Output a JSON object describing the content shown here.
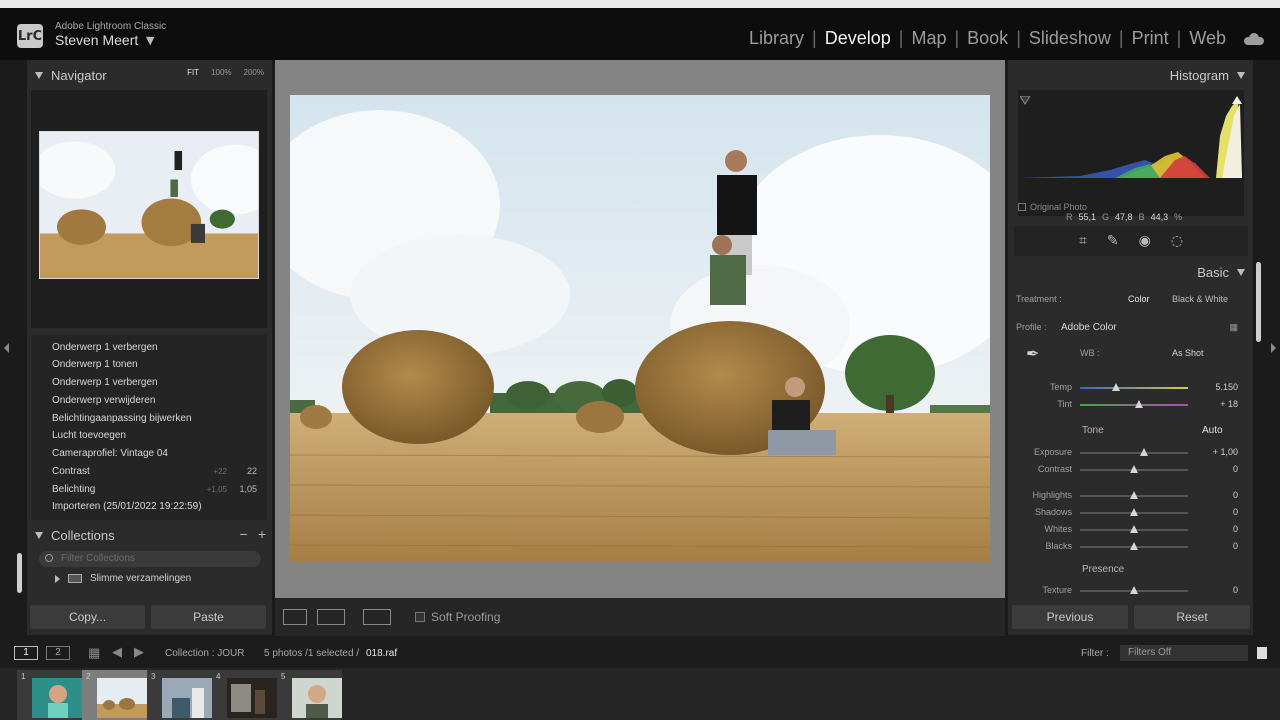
{
  "app": {
    "name": "Adobe Lightroom Classic",
    "logo": "LrC",
    "user": "Steven Meert"
  },
  "modules": [
    "Library",
    "Develop",
    "Map",
    "Book",
    "Slideshow",
    "Print",
    "Web"
  ],
  "active_module": "Develop",
  "navigator": {
    "title": "Navigator",
    "zoom": [
      "FIT",
      "100%",
      "200%"
    ]
  },
  "history": [
    {
      "label": "Onderwerp 1 verbergen",
      "old": "",
      "new": ""
    },
    {
      "label": "Onderwerp 1 tonen",
      "old": "",
      "new": ""
    },
    {
      "label": "Onderwerp 1 verbergen",
      "old": "",
      "new": ""
    },
    {
      "label": "Onderwerp verwijderen",
      "old": "",
      "new": ""
    },
    {
      "label": "Belichtingaanpassing bijwerken",
      "old": "",
      "new": ""
    },
    {
      "label": "Lucht toevoegen",
      "old": "",
      "new": ""
    },
    {
      "label": "Cameraprofiel: Vintage 04",
      "old": "",
      "new": ""
    },
    {
      "label": "Contrast",
      "old": "+22",
      "new": "22"
    },
    {
      "label": "Belichting",
      "old": "+1,05",
      "new": "1,05"
    },
    {
      "label": "Importeren (25/01/2022 19:22:59)",
      "old": "",
      "new": ""
    }
  ],
  "collections": {
    "title": "Collections",
    "filter_placeholder": "Filter Collections",
    "item": "Slimme verzamelingen",
    "minus": "−",
    "plus": "+"
  },
  "left_buttons": {
    "copy": "Copy...",
    "paste": "Paste"
  },
  "toolbar": {
    "soft_proofing": "Soft Proofing"
  },
  "histogram": {
    "title": "Histogram",
    "r_label": "R",
    "r": "55,1",
    "g_label": "G",
    "g": "47,8",
    "b_label": "B",
    "b": "44,3",
    "unit": "%",
    "original_photo": "Original Photo"
  },
  "basic": {
    "title": "Basic",
    "treatment_label": "Treatment :",
    "treatment_color": "Color",
    "treatment_bw": "Black & White",
    "profile_label": "Profile :",
    "profile_value": "Adobe Color",
    "wb_label": "WB :",
    "wb_value": "As Shot",
    "temp": {
      "label": "Temp",
      "value": "5.150",
      "pos": 0.33
    },
    "tint": {
      "label": "Tint",
      "value": "+ 18",
      "pos": 0.55
    },
    "tone_label": "Tone",
    "auto": "Auto",
    "exposure": {
      "label": "Exposure",
      "value": "+ 1,00",
      "pos": 0.59
    },
    "contrast": {
      "label": "Contrast",
      "value": "0",
      "pos": 0.5
    },
    "highlights": {
      "label": "Highlights",
      "value": "0",
      "pos": 0.5
    },
    "shadows": {
      "label": "Shadows",
      "value": "0",
      "pos": 0.5
    },
    "whites": {
      "label": "Whites",
      "value": "0",
      "pos": 0.5
    },
    "blacks": {
      "label": "Blacks",
      "value": "0",
      "pos": 0.5
    },
    "presence_label": "Presence",
    "texture": {
      "label": "Texture",
      "value": "0",
      "pos": 0.5
    }
  },
  "right_buttons": {
    "previous": "Previous",
    "reset": "Reset"
  },
  "filmstrip": {
    "screen1": "1",
    "screen2": "2",
    "collection": "Collection : JOUR",
    "count": "5 photos /1 selected /",
    "file": "018.raf",
    "filter_label": "Filter :",
    "filter_value": "Filters Off",
    "thumbs": [
      "1",
      "2",
      "3",
      "4",
      "5"
    ]
  }
}
